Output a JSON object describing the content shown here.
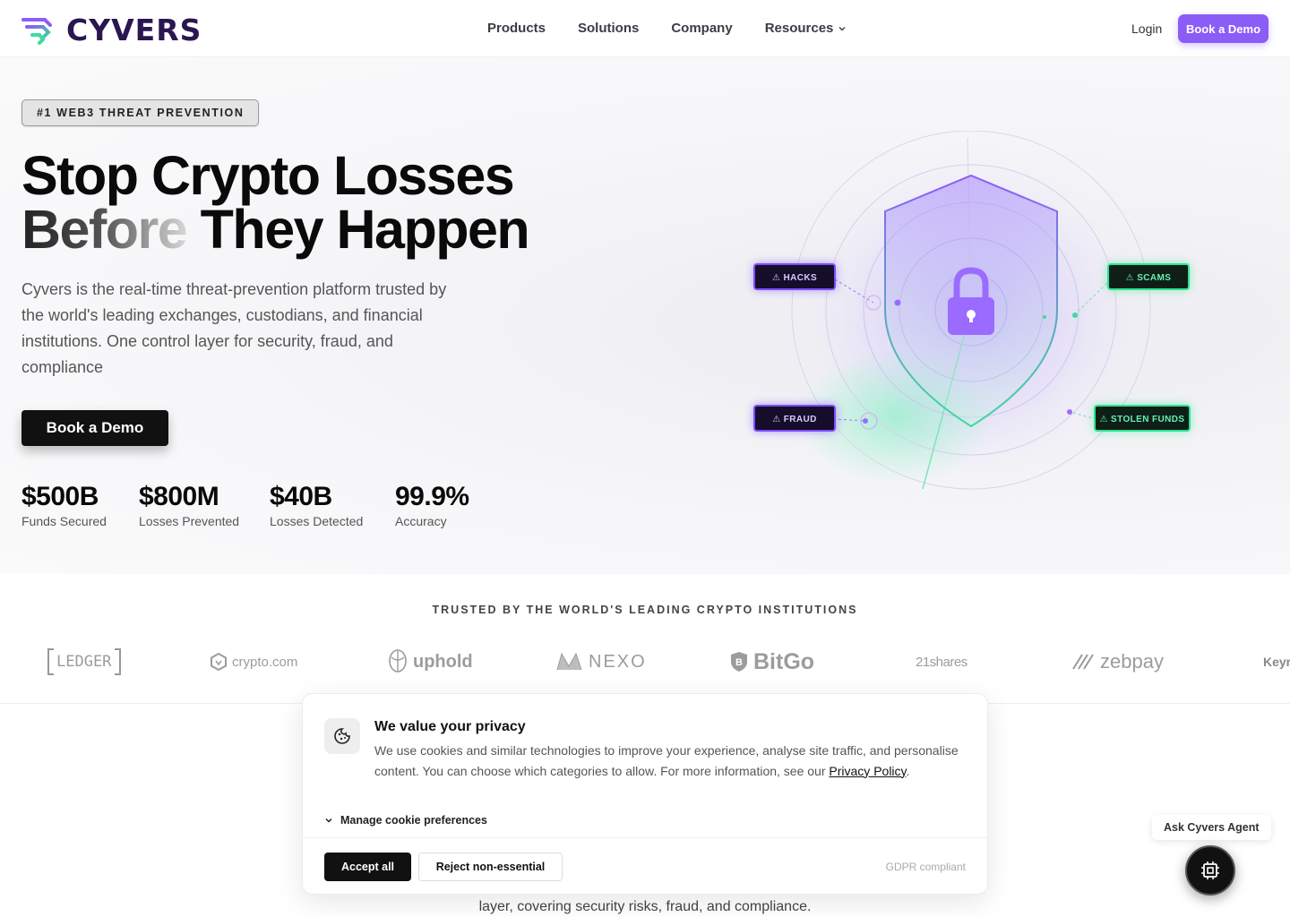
{
  "brand": {
    "name": "CYVERS"
  },
  "nav": {
    "links": [
      "Products",
      "Solutions",
      "Company",
      "Resources"
    ],
    "login": "Login",
    "cta": "Book a Demo"
  },
  "hero": {
    "badge": "#1 WEB3 THREAT PREVENTION",
    "headline_line1": "Stop Crypto Losses",
    "headline_fade": "Before",
    "headline_rest": "They Happen",
    "description": "Cyvers is the real-time threat-prevention platform trusted by the world's leading exchanges, custodians, and financial institutions. One control layer for security, fraud, and compliance",
    "cta": "Book a Demo",
    "stats": [
      {
        "value": "$500B",
        "label": "Funds Secured"
      },
      {
        "value": "$800M",
        "label": "Losses Prevented"
      },
      {
        "value": "$40B",
        "label": "Losses Detected"
      },
      {
        "value": "99.9%",
        "label": "Accuracy"
      }
    ],
    "threat_tags": {
      "hacks": "⚠ HACKS",
      "scams": "⚠ SCAMS",
      "fraud": "⚠ FRAUD",
      "stolen": "⚠ STOLEN FUNDS"
    },
    "colors": {
      "purple": "#8b5cf6",
      "green": "#2ee58f"
    }
  },
  "trusted": {
    "title": "TRUSTED BY THE WORLD'S LEADING CRYPTO INSTITUTIONS",
    "logos": [
      "LEDGER",
      "crypto.com",
      "uphold",
      "NEXO",
      "BitGo",
      "21shares",
      "zebpay",
      "Keyr"
    ]
  },
  "below": {
    "text": "layer, covering security risks, fraud, and compliance."
  },
  "cookie": {
    "title": "We value your privacy",
    "body": "We use cookies and similar technologies to improve your experience, analyse site traffic, and personalise content. You can choose which categories to allow. For more information, see our ",
    "link": "Privacy Policy",
    "body_end": ".",
    "manage": "Manage cookie preferences",
    "accept": "Accept all",
    "reject": "Reject non-essential",
    "gdpr": "GDPR compliant"
  },
  "agent": {
    "label": "Ask Cyvers Agent"
  }
}
